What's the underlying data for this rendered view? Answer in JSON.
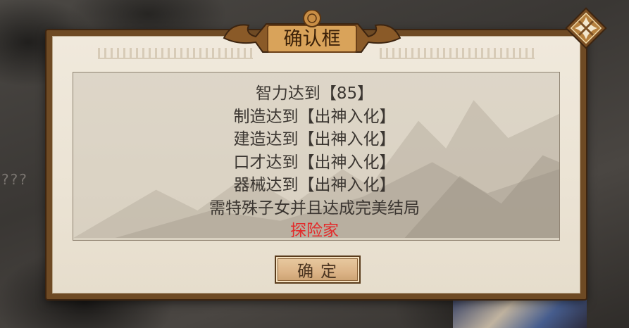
{
  "dialog": {
    "title": "确认框",
    "lines": [
      "智力达到【85】",
      "制造达到【出神入化】",
      "建造达到【出神入化】",
      "口才达到【出神入化】",
      "器械达到【出神入化】",
      "需特殊子女并且达成完美结局"
    ],
    "highlight": "探险家",
    "confirm_label": "确定"
  },
  "background": {
    "side_text": "???"
  },
  "colors": {
    "highlight": "#e32b2b",
    "frame": "#6e4a24",
    "paper": "#ebe3d4"
  },
  "icons": {
    "close": "close-icon"
  }
}
